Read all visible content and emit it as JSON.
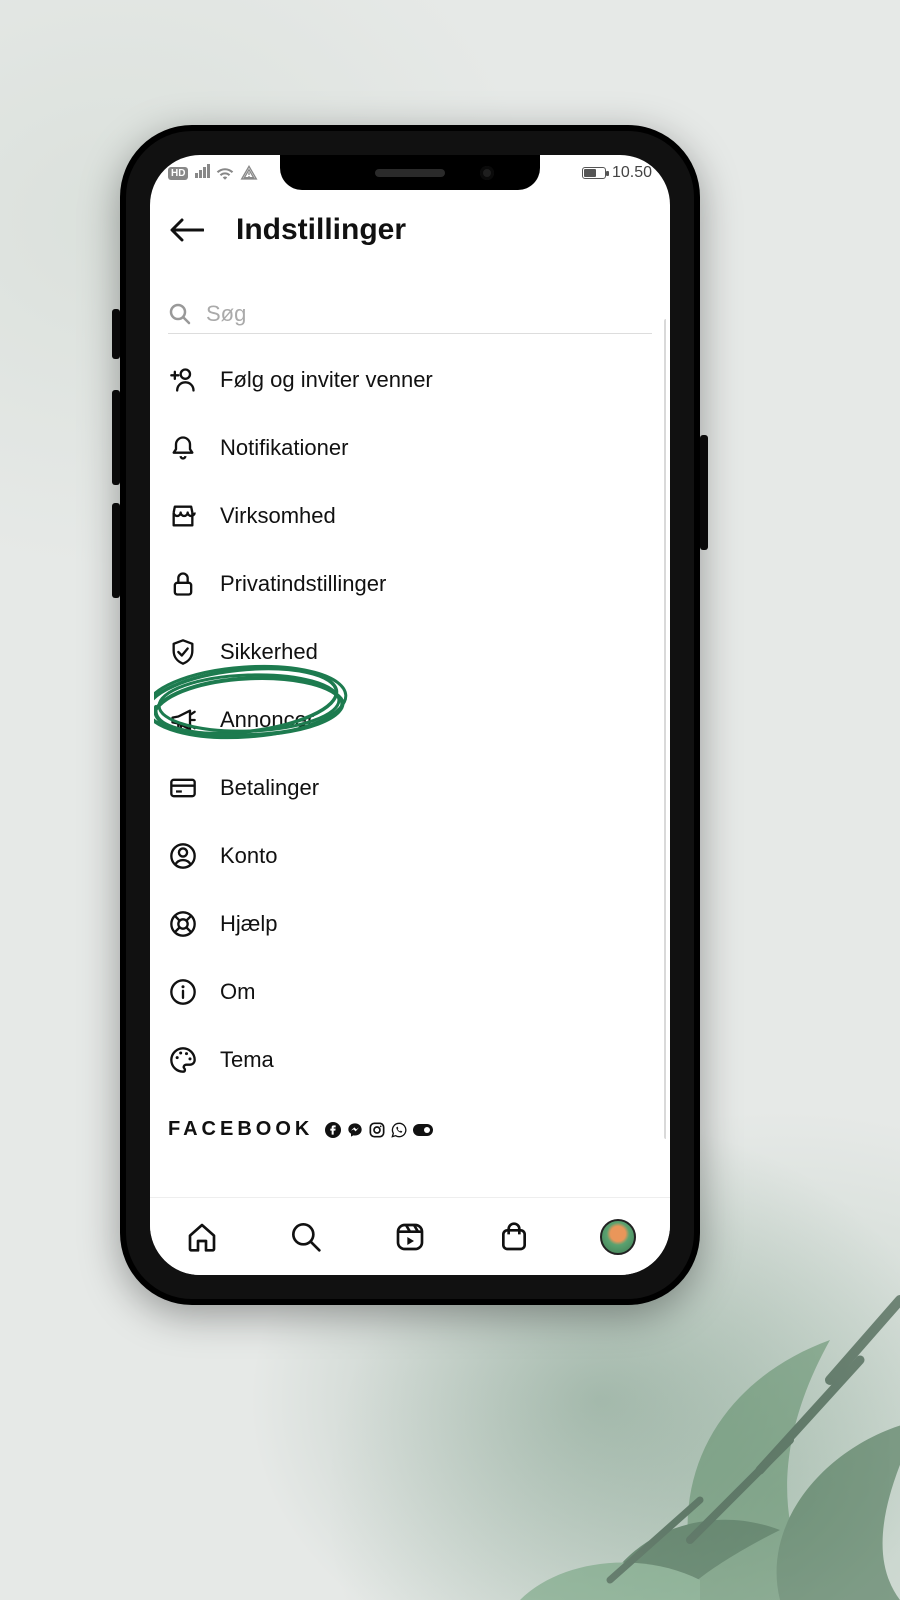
{
  "status": {
    "hd": "HD",
    "time": "10.50"
  },
  "header": {
    "title": "Indstillinger"
  },
  "search": {
    "placeholder": "Søg",
    "value": ""
  },
  "menu": [
    {
      "key": "invite",
      "label": "Følg og inviter venner",
      "icon": "person-plus"
    },
    {
      "key": "notif",
      "label": "Notifikationer",
      "icon": "bell"
    },
    {
      "key": "business",
      "label": "Virksomhed",
      "icon": "storefront"
    },
    {
      "key": "privacy",
      "label": "Privatindstillinger",
      "icon": "lock"
    },
    {
      "key": "security",
      "label": "Sikkerhed",
      "icon": "shield-check",
      "highlighted": true
    },
    {
      "key": "ads",
      "label": "Annoncer",
      "icon": "megaphone"
    },
    {
      "key": "payments",
      "label": "Betalinger",
      "icon": "card"
    },
    {
      "key": "account",
      "label": "Konto",
      "icon": "user-circle"
    },
    {
      "key": "help",
      "label": "Hjælp",
      "icon": "lifebuoy"
    },
    {
      "key": "about",
      "label": "Om",
      "icon": "info"
    },
    {
      "key": "theme",
      "label": "Tema",
      "icon": "palette"
    }
  ],
  "facebook": {
    "brand": "FACEBOOK",
    "apps": [
      "facebook",
      "messenger",
      "instagram",
      "whatsapp",
      "oculus"
    ]
  },
  "bottomnav": {
    "items": [
      "home",
      "search",
      "reels",
      "shop",
      "profile"
    ]
  },
  "colors": {
    "highlight": "#1d7b4f"
  }
}
